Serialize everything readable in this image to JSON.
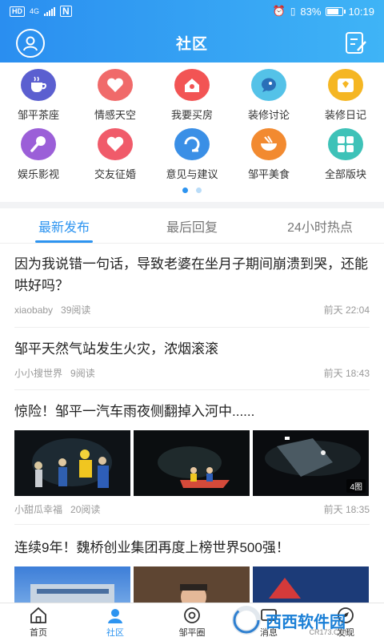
{
  "status_bar": {
    "net_tag": "HD",
    "net_type": "4G",
    "battery_pct": "83%",
    "time": "10:19",
    "battery_level": 0.83
  },
  "header": {
    "title": "社区",
    "left_icon": "user-avatar-icon",
    "right_icon": "edit-note-icon"
  },
  "categories": [
    {
      "label": "邹平茶座",
      "icon": "teacup-icon",
      "color": "#5b5fd0"
    },
    {
      "label": "情感天空",
      "icon": "heart-hands-icon",
      "color": "#f06a6a"
    },
    {
      "label": "我要买房",
      "icon": "house-icon",
      "color": "#f25454"
    },
    {
      "label": "装修讨论",
      "icon": "chat-bubble-icon",
      "color": "#54c2e8"
    },
    {
      "label": "装修日记",
      "icon": "diary-icon",
      "color": "#f5b623"
    },
    {
      "label": "娱乐影视",
      "icon": "microphone-icon",
      "color": "#9b5fd8"
    },
    {
      "label": "交友征婚",
      "icon": "love-heart-icon",
      "color": "#f05b6a"
    },
    {
      "label": "意见与建议",
      "icon": "feedback-icon",
      "color": "#3a8fe6"
    },
    {
      "label": "邹平美食",
      "icon": "food-bowl-icon",
      "color": "#f28a30"
    },
    {
      "label": "全部版块",
      "icon": "grid-icon",
      "color": "#3ec2b8"
    }
  ],
  "tabs": [
    {
      "label": "最新发布",
      "active": true
    },
    {
      "label": "最后回复",
      "active": false
    },
    {
      "label": "24小时热点",
      "active": false
    }
  ],
  "posts": [
    {
      "title": "因为我说错一句话，导致老婆在坐月子期间崩溃到哭，还能哄好吗？",
      "author": "xiaobaby",
      "reads": "39阅读",
      "time": "前天 22:04"
    },
    {
      "title": "邹平天然气站发生火灾，浓烟滚滚",
      "author": "小小搜世界",
      "reads": "9阅读",
      "time": "前天 18:43"
    },
    {
      "title": "惊险！邹平一汽车雨夜侧翻掉入河中......",
      "author": "小甜瓜幸福",
      "reads": "20阅读",
      "time": "前天 18:35",
      "image_count": "4图"
    },
    {
      "title": "连续9年！魏桥创业集团再度上榜世界500强！"
    }
  ],
  "bottom_tabs": [
    {
      "label": "首页",
      "icon": "home-icon",
      "active": false
    },
    {
      "label": "社区",
      "icon": "community-icon",
      "active": true
    },
    {
      "label": "邹平圈",
      "icon": "circle-eye-icon",
      "active": false
    },
    {
      "label": "消息",
      "icon": "message-icon",
      "active": false
    },
    {
      "label": "发现",
      "icon": "discover-icon",
      "active": false
    }
  ],
  "watermark": {
    "text": "西西软件园",
    "sub": "CR173.COM"
  },
  "colors": {
    "accent": "#2d94f0",
    "header_start": "#2a8ef0",
    "header_end": "#3fb4f6"
  }
}
